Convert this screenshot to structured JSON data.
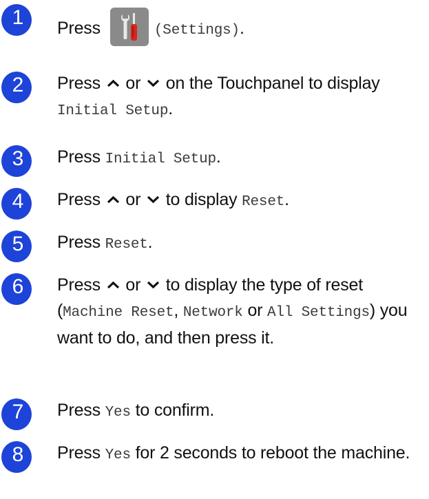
{
  "colors": {
    "badge": "#1e43d8",
    "text": "#111111",
    "ui_text": "#3a3a3a"
  },
  "steps": [
    {
      "number": "1",
      "press": "Press",
      "icon": "settings-icon",
      "settings_label": "(Settings)",
      "end": "."
    },
    {
      "number": "2",
      "press": "Press",
      "or": "or",
      "tail": "on the Touchpanel to display",
      "target": "Initial Setup",
      "end": "."
    },
    {
      "number": "3",
      "press": "Press",
      "target": "Initial Setup",
      "end": "."
    },
    {
      "number": "4",
      "press": "Press",
      "or": "or",
      "tail": "to display",
      "target": "Reset",
      "end": "."
    },
    {
      "number": "5",
      "press": "Press",
      "target": "Reset",
      "end": "."
    },
    {
      "number": "6",
      "press": "Press",
      "or": "or",
      "tail": "to display the type of reset (",
      "opt1": "Machine Reset",
      "comma": ",",
      "opt2": "Network",
      "or2": "or",
      "opt3": "All Settings",
      "after": ") you want to do, and then press it."
    },
    {
      "number": "7",
      "press": "Press",
      "target": "Yes",
      "tail": "to confirm."
    },
    {
      "number": "8",
      "press": "Press",
      "target": "Yes",
      "tail": "for 2 seconds to reboot the machine."
    }
  ]
}
